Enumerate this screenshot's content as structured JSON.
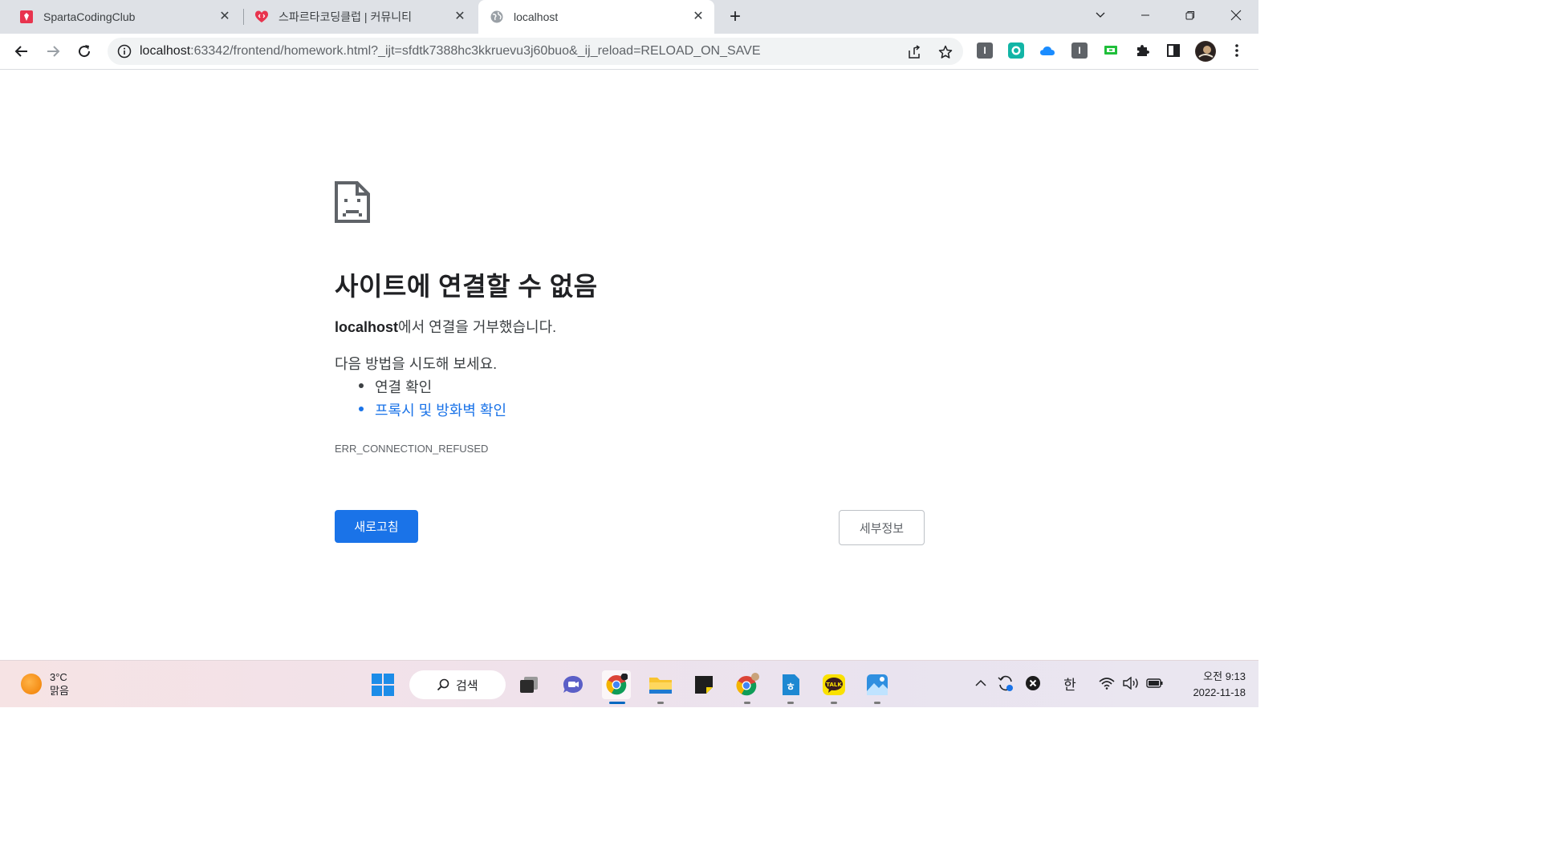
{
  "browser": {
    "tabs": [
      {
        "title": "SpartaCodingClub",
        "favicon": "sparta-icon",
        "active": false
      },
      {
        "title": "스파르타코딩클럽 | 커뮤니티",
        "favicon": "heart-code-icon",
        "active": false
      },
      {
        "title": "localhost",
        "favicon": "globe-icon",
        "active": true
      }
    ],
    "address": {
      "host": "localhost",
      "rest": ":63342/frontend/homework.html?_ijt=sfdtk7388hc3kkruevu3j60buo&_ij_reload=RELOAD_ON_SAVE"
    }
  },
  "error_page": {
    "title": "사이트에 연결할 수 없음",
    "host": "localhost",
    "description_suffix": "에서 연결을 거부했습니다.",
    "suggestion_heading": "다음 방법을 시도해 보세요.",
    "suggestions": [
      {
        "text": "연결 확인",
        "is_link": false
      },
      {
        "text": "프록시 및 방화벽 확인",
        "is_link": true
      }
    ],
    "error_code": "ERR_CONNECTION_REFUSED",
    "reload_label": "새로고침",
    "details_label": "세부정보"
  },
  "taskbar": {
    "weather": {
      "temperature": "3°C",
      "condition": "맑음"
    },
    "search_label": "검색",
    "ime": "한",
    "time": "오전 9:13",
    "date": "2022-11-18"
  },
  "colors": {
    "accent": "#1a73e8",
    "tabstrip": "#dee1e6"
  }
}
